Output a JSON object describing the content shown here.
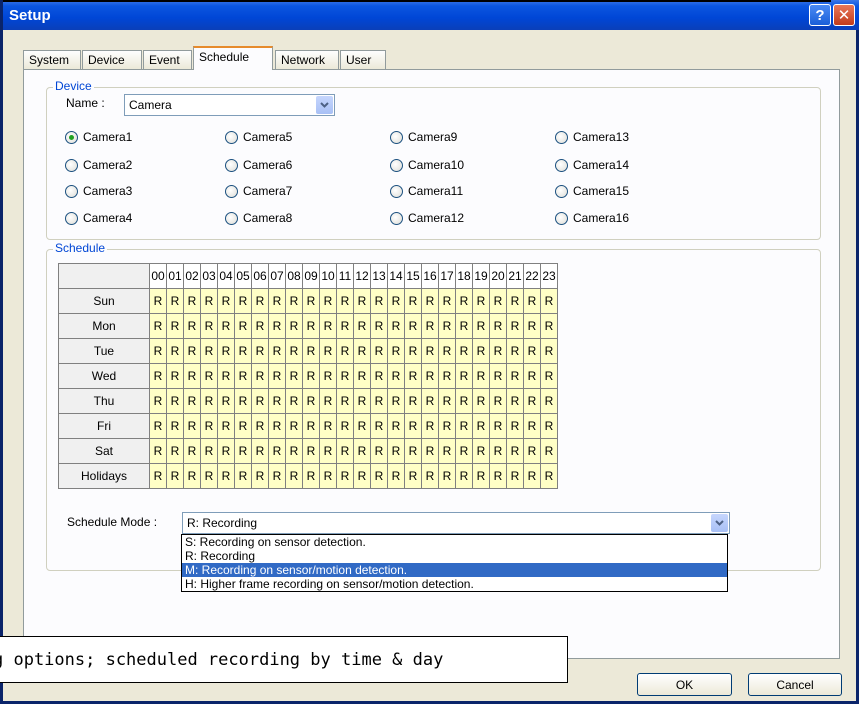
{
  "window": {
    "title": "Setup",
    "help_label": "?",
    "close_label": "✕"
  },
  "tabs": [
    {
      "label": "System",
      "active": false
    },
    {
      "label": "Device",
      "active": false
    },
    {
      "label": "Event",
      "active": false
    },
    {
      "label": "Schedule",
      "active": true
    },
    {
      "label": "Network",
      "active": false
    },
    {
      "label": "User",
      "active": false
    }
  ],
  "device": {
    "group_title": "Device",
    "name_label": "Name :",
    "name_value": "Camera",
    "cameras": [
      "Camera1",
      "Camera5",
      "Camera9",
      "Camera13",
      "Camera2",
      "Camera6",
      "Camera10",
      "Camera14",
      "Camera3",
      "Camera7",
      "Camera11",
      "Camera15",
      "Camera4",
      "Camera8",
      "Camera12",
      "Camera16"
    ],
    "selected_camera": "Camera1"
  },
  "schedule": {
    "group_title": "Schedule",
    "hours": [
      "00",
      "01",
      "02",
      "03",
      "04",
      "05",
      "06",
      "07",
      "08",
      "09",
      "10",
      "11",
      "12",
      "13",
      "14",
      "15",
      "16",
      "17",
      "18",
      "19",
      "20",
      "21",
      "22",
      "23"
    ],
    "days": [
      "Sun",
      "Mon",
      "Tue",
      "Wed",
      "Thu",
      "Fri",
      "Sat",
      "Holidays"
    ],
    "cell_value": "R",
    "mode_label": "Schedule Mode :",
    "mode_value": "R: Recording",
    "mode_options": [
      "S: Recording on sensor detection.",
      "R: Recording",
      "M: Recording on sensor/motion detection.",
      "H: Higher frame recording on sensor/motion detection."
    ],
    "mode_highlighted_index": 2
  },
  "buttons": {
    "ok": "OK",
    "cancel": "Cancel"
  },
  "caption": "g options; scheduled recording by time & day"
}
